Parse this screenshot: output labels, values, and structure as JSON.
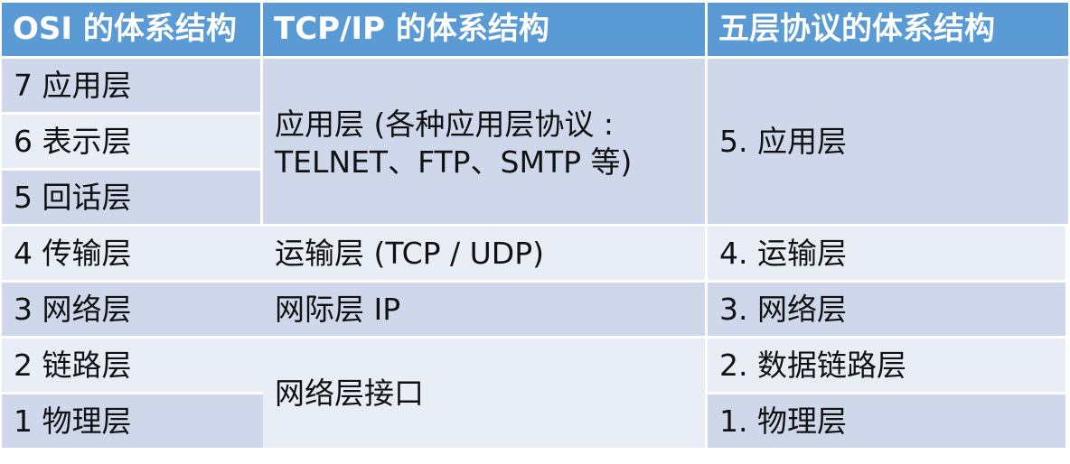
{
  "table": {
    "headers": {
      "osi": "OSI 的体系结构",
      "tcpip": "TCP/IP 的体系结构",
      "five_layer": "五层协议的体系结构"
    },
    "osi_layers": [
      "7 应用层",
      "6 表示层",
      "5 回话层",
      "4 传输层",
      "3 网络层",
      "2 链路层",
      "1 物理层"
    ],
    "tcpip_layers": {
      "application": "应用层 (各种应用层协议 :\nTELNET、FTP、SMTP 等)",
      "transport": "运输层 (TCP / UDP)",
      "internet": "网际层 IP",
      "network_interface": "网络层接口"
    },
    "five_layers": {
      "application": "5. 应用层",
      "transport": "4. 运输层",
      "network": "3. 网络层",
      "data_link": "2. 数据链路层",
      "physical": "1. 物理层"
    }
  }
}
